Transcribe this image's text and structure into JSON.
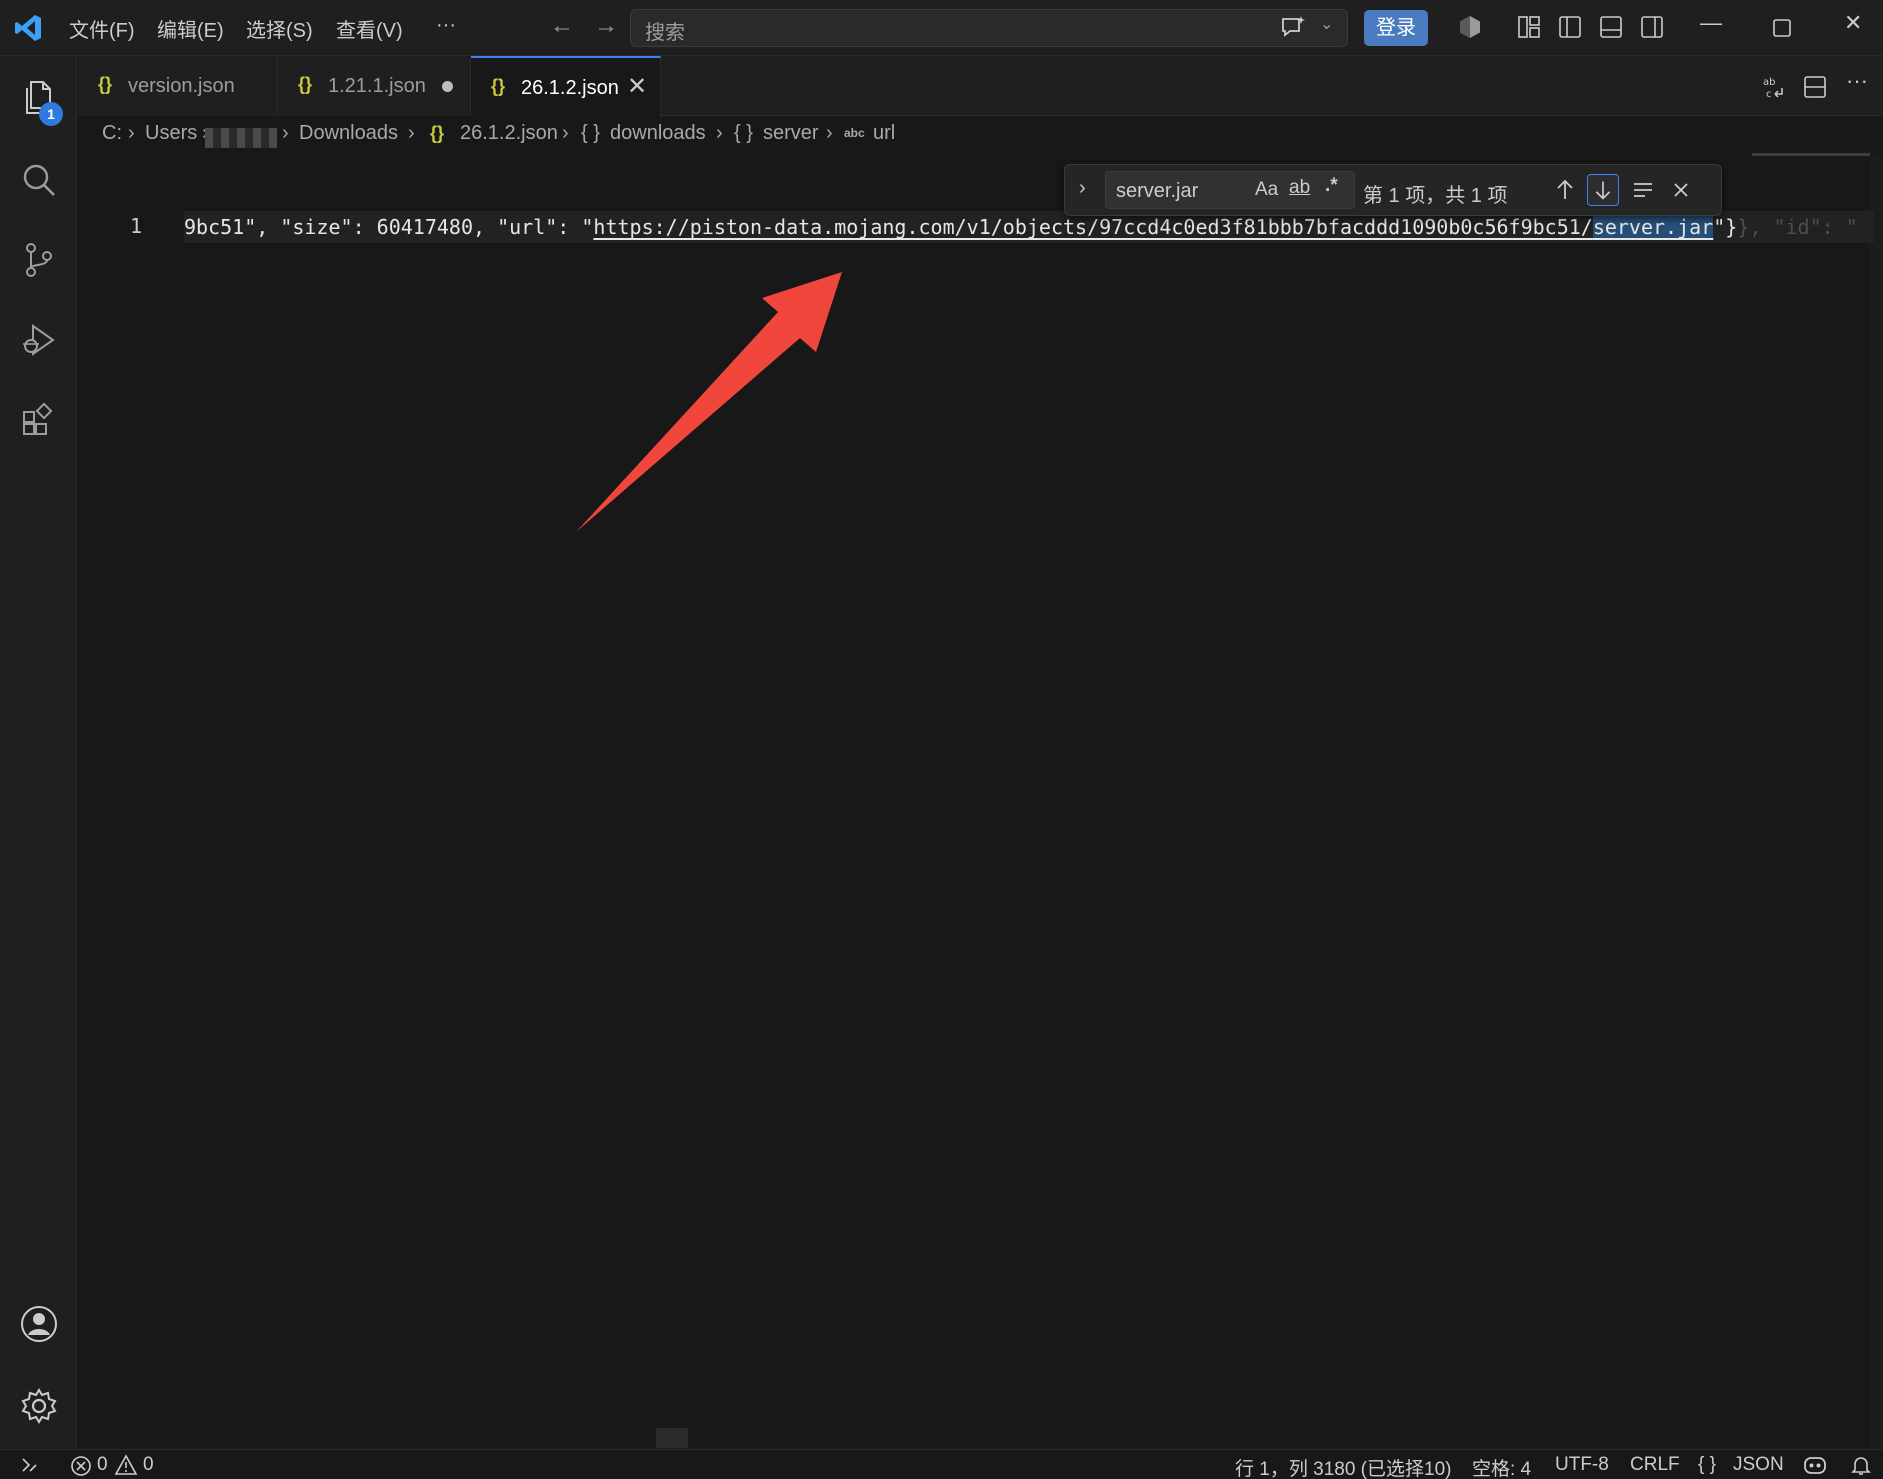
{
  "titlebar": {
    "menus": [
      "文件(F)",
      "编辑(E)",
      "选择(S)",
      "查看(V)",
      "···"
    ],
    "search_placeholder": "搜索",
    "login_label": "登录"
  },
  "activity": {
    "explorer_badge": "1"
  },
  "tabs": [
    {
      "icon": "{}",
      "label": "version.json",
      "modified": false,
      "active": false
    },
    {
      "icon": "{}",
      "label": "1.21.1.json",
      "modified": true,
      "active": false
    },
    {
      "icon": "{}",
      "label": "26.1.2.json",
      "modified": false,
      "active": true
    }
  ],
  "breadcrumb": {
    "drive": "C:",
    "users": "Users",
    "downloads": "Downloads",
    "file": "26.1.2.json",
    "downloads_node": "downloads",
    "server_node": "server",
    "url_node": "url",
    "obj_icon": "{ }",
    "file_icon": "{}",
    "string_icon": "abc"
  },
  "editor": {
    "line_number": "1",
    "code": {
      "prefix": "9bc51\", \"size\": 60417480, \"url\": \"",
      "url_main": "https://piston-data.mojang.com/v1/objects/97ccd4c0ed3f81bbb7bfacddd1090b0c56f9bc51/",
      "url_match": "server.jar",
      "suffix": "\"}",
      "ghost": "}, \"id\": \""
    }
  },
  "find": {
    "query": "server.jar",
    "match_case": "Aa",
    "whole_word": "ab",
    "regex": ".*",
    "count": "第 1 项，共 1 项"
  },
  "statusbar": {
    "errors": "0",
    "warnings": "0",
    "position": "行 1，列 3180 (已选择10)",
    "indent": "空格: 4",
    "encoding": "UTF-8",
    "eol": "CRLF",
    "language_icon": "{ }",
    "language": "JSON"
  },
  "colors": {
    "accent": "#3b82f6",
    "login_button": "#4a7bc0",
    "json_icon": "#cbcb41",
    "annotation_arrow": "#f0463c",
    "selection": "#264f78"
  }
}
